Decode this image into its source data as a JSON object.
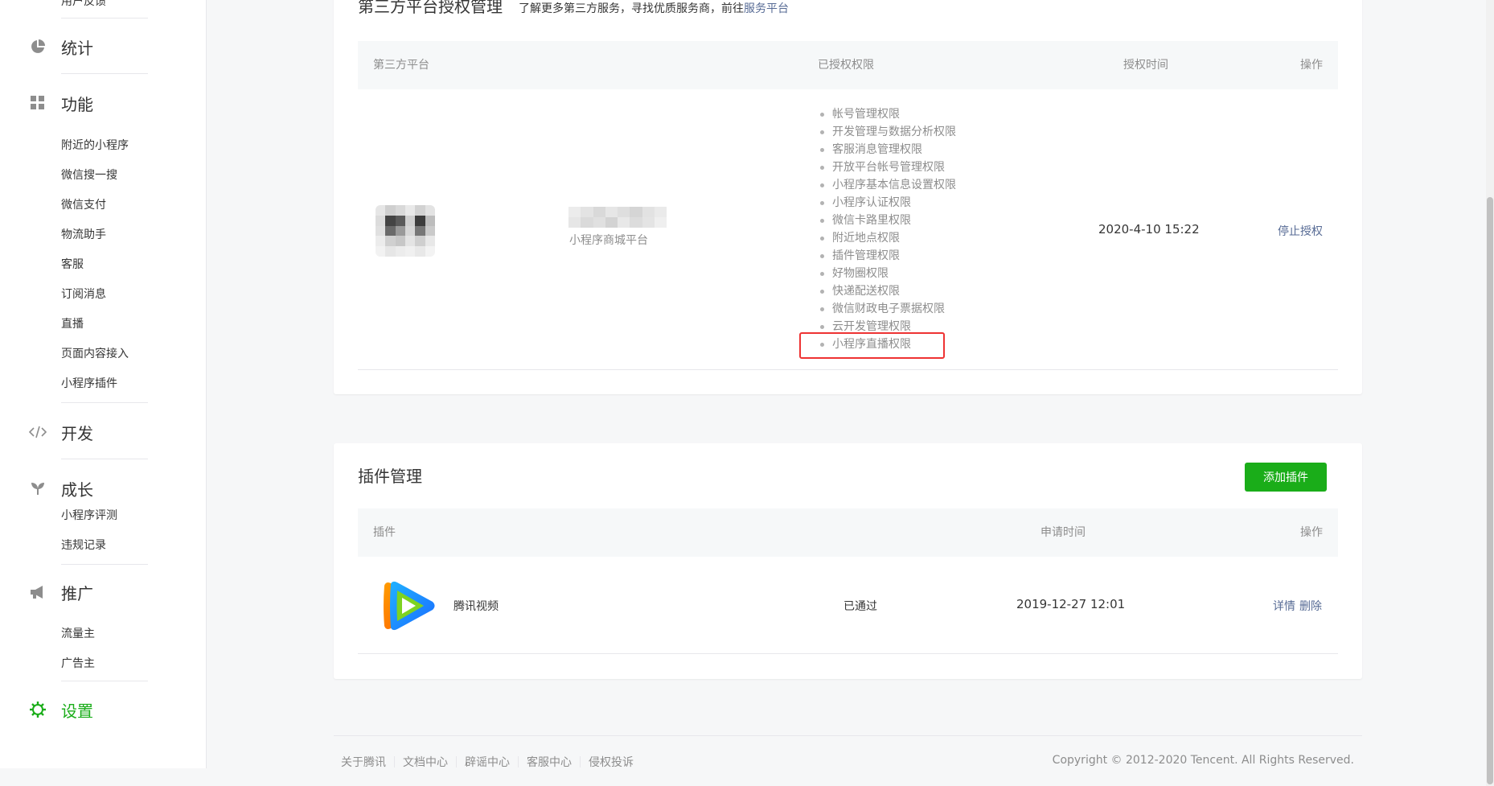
{
  "sidebar": {
    "cut_item": "用户反馈",
    "sections": [
      {
        "label": "统计",
        "icon": "pie-chart-icon"
      },
      {
        "label": "功能",
        "icon": "grid-icon",
        "items": [
          "附近的小程序",
          "微信搜一搜",
          "微信支付",
          "物流助手",
          "客服",
          "订阅消息",
          "直播",
          "页面内容接入",
          "小程序插件"
        ]
      },
      {
        "label": "开发",
        "icon": "code-icon"
      },
      {
        "label": "成长",
        "icon": "sprout-icon",
        "items": [
          "小程序评测",
          "违规记录"
        ]
      },
      {
        "label": "推广",
        "icon": "megaphone-icon",
        "items": [
          "流量主",
          "广告主"
        ]
      },
      {
        "label": "设置",
        "icon": "gear-icon",
        "active": true
      }
    ]
  },
  "auth_section": {
    "title": "第三方平台授权管理",
    "desc_prefix": "了解更多第三方服务，寻找优质服务商，前往",
    "desc_link": "服务平台",
    "columns": [
      "第三方平台",
      "已授权权限",
      "授权时间",
      "操作"
    ],
    "row": {
      "platform_label": "小程序商城平台",
      "permissions": [
        "帐号管理权限",
        "开发管理与数据分析权限",
        "客服消息管理权限",
        "开放平台帐号管理权限",
        "小程序基本信息设置权限",
        "小程序认证权限",
        "微信卡路里权限",
        "附近地点权限",
        "插件管理权限",
        "好物圈权限",
        "快递配送权限",
        "微信财政电子票据权限",
        "云开发管理权限",
        "小程序直播权限"
      ],
      "auth_time": "2020-4-10 15:22",
      "action": "停止授权"
    }
  },
  "plugin_section": {
    "title": "插件管理",
    "add_button": "添加插件",
    "columns": [
      "插件",
      "申请时间",
      "操作"
    ],
    "row": {
      "name": "腾讯视频",
      "status": "已通过",
      "apply_time": "2019-12-27 12:01",
      "action_detail": "详情",
      "action_delete": "删除"
    }
  },
  "footer": {
    "links": [
      "关于腾讯",
      "文档中心",
      "辟谣中心",
      "客服中心",
      "侵权投诉"
    ],
    "copyright": "Copyright © 2012-2020 Tencent. All Rights Reserved."
  },
  "colors": {
    "accent": "#1aad19",
    "link": "#576b95",
    "highlight": "#e33333"
  }
}
